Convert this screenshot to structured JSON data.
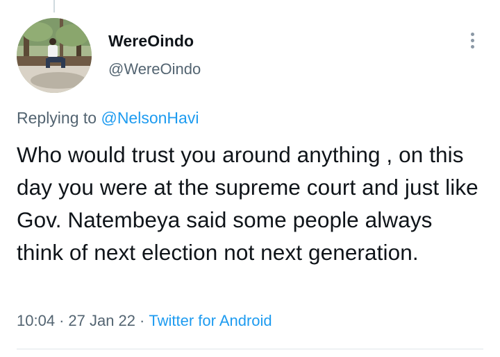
{
  "tweet": {
    "author": {
      "display_name": "WereOindo",
      "handle": "@WereOindo"
    },
    "replying": {
      "prefix": "Replying to",
      "mention": "@NelsonHavi"
    },
    "text": "Who would trust you around anything , on this day you were at the supreme court and just like Gov. Natembeya said some people always think of next election not next generation.",
    "meta": {
      "time": "10:04",
      "separator": "·",
      "date": "27 Jan 22",
      "source": "Twitter for Android"
    }
  },
  "icons": {
    "more": "more-options-icon",
    "avatar": "profile-photo"
  },
  "colors": {
    "text": "#0f1419",
    "secondary": "#536471",
    "link": "#1d9bf0",
    "divider": "#dfe5e9"
  }
}
